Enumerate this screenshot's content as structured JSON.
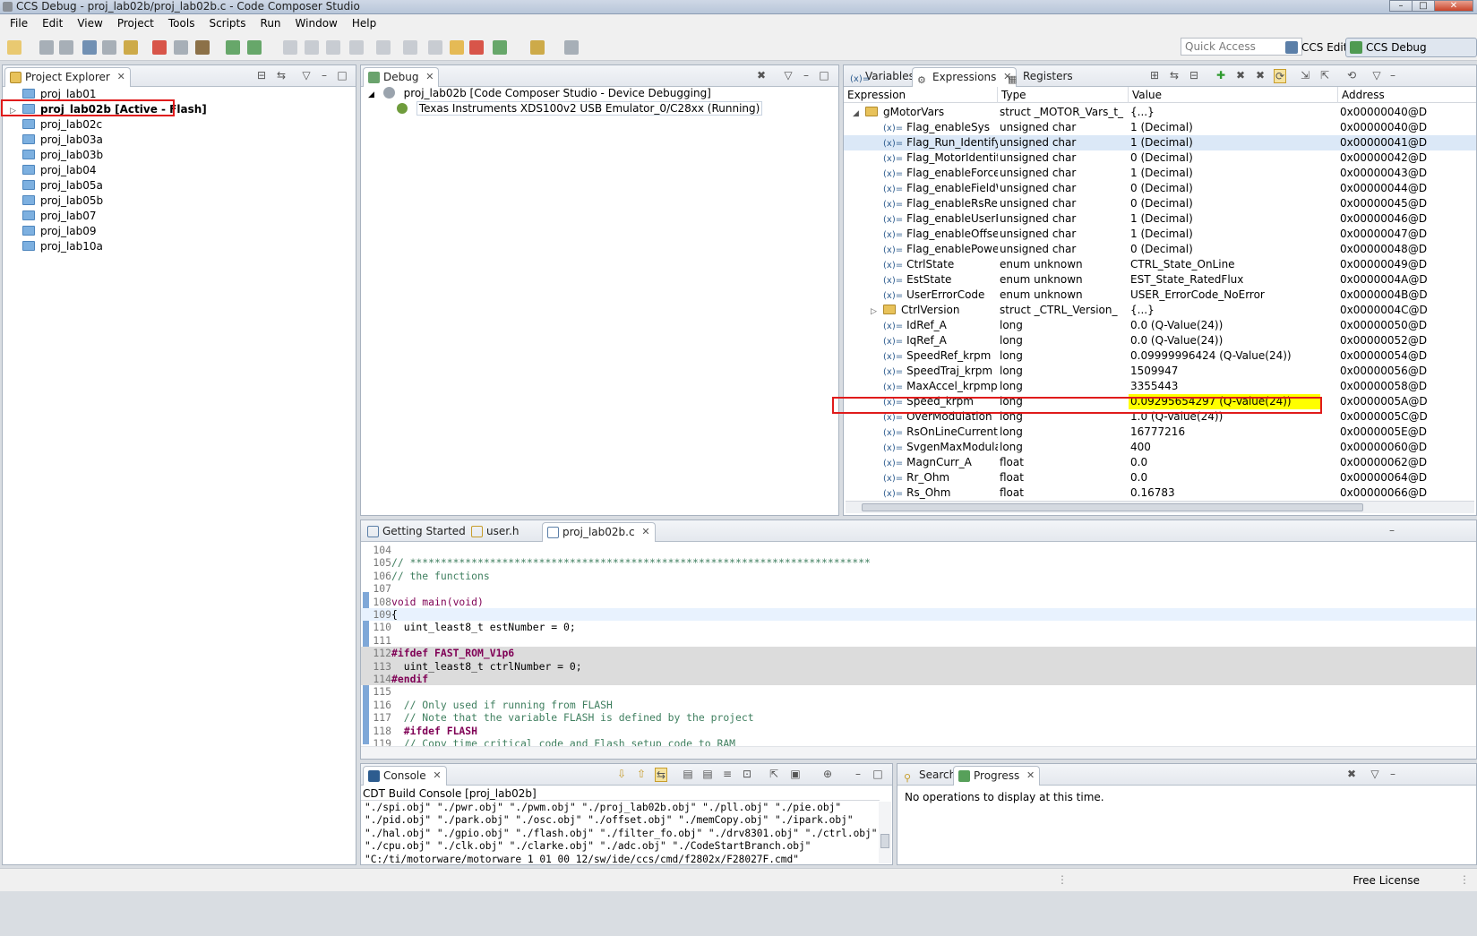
{
  "window": {
    "title": "CCS Debug - proj_lab02b/proj_lab02b.c - Code Composer Studio"
  },
  "menu": [
    "File",
    "Edit",
    "View",
    "Project",
    "Tools",
    "Scripts",
    "Run",
    "Window",
    "Help"
  ],
  "toolbar": {
    "quick_access_placeholder": "Quick Access",
    "perspectives": [
      "CCS Edit",
      "CCS Debug"
    ]
  },
  "project_explorer": {
    "tab": "Project Explorer",
    "items": [
      {
        "label": "proj_lab01",
        "active": false
      },
      {
        "label": "proj_lab02b  [Active - Flash]",
        "active": true
      },
      {
        "label": "proj_lab02c",
        "active": false
      },
      {
        "label": "proj_lab03a",
        "active": false
      },
      {
        "label": "proj_lab03b",
        "active": false
      },
      {
        "label": "proj_lab04",
        "active": false
      },
      {
        "label": "proj_lab05a",
        "active": false
      },
      {
        "label": "proj_lab05b",
        "active": false
      },
      {
        "label": "proj_lab07",
        "active": false
      },
      {
        "label": "proj_lab09",
        "active": false
      },
      {
        "label": "proj_lab10a",
        "active": false
      }
    ]
  },
  "debug": {
    "tab": "Debug",
    "session": "proj_lab02b [Code Composer Studio - Device Debugging]",
    "target": "Texas Instruments XDS100v2 USB Emulator_0/C28xx (Running)"
  },
  "expressions": {
    "tabs": [
      "Variables",
      "Expressions",
      "Registers"
    ],
    "columns": [
      "Expression",
      "Type",
      "Value",
      "Address"
    ],
    "rows": [
      {
        "name": "gMotorVars",
        "type": "struct _MOTOR_Vars_t_",
        "value": "{...}",
        "address": "0x00000040@D",
        "kind": "struct",
        "expanded": true
      },
      {
        "name": "Flag_enableSys",
        "type": "unsigned char",
        "value": "1 (Decimal)",
        "address": "0x00000040@D",
        "kind": "var"
      },
      {
        "name": "Flag_Run_Identify",
        "type": "unsigned char",
        "value": "1 (Decimal)",
        "address": "0x00000041@D",
        "kind": "var",
        "selected": true
      },
      {
        "name": "Flag_MotorIdentified",
        "type": "unsigned char",
        "value": "0 (Decimal)",
        "address": "0x00000042@D",
        "kind": "var"
      },
      {
        "name": "Flag_enableForceAng",
        "type": "unsigned char",
        "value": "1 (Decimal)",
        "address": "0x00000043@D",
        "kind": "var"
      },
      {
        "name": "Flag_enableFieldWeak",
        "type": "unsigned char",
        "value": "0 (Decimal)",
        "address": "0x00000044@D",
        "kind": "var"
      },
      {
        "name": "Flag_enableRsRecalc",
        "type": "unsigned char",
        "value": "0 (Decimal)",
        "address": "0x00000045@D",
        "kind": "var"
      },
      {
        "name": "Flag_enableUserParan",
        "type": "unsigned char",
        "value": "1 (Decimal)",
        "address": "0x00000046@D",
        "kind": "var"
      },
      {
        "name": "Flag_enableOffsetcalc",
        "type": "unsigned char",
        "value": "1 (Decimal)",
        "address": "0x00000047@D",
        "kind": "var"
      },
      {
        "name": "Flag_enablePowerWar",
        "type": "unsigned char",
        "value": "0 (Decimal)",
        "address": "0x00000048@D",
        "kind": "var"
      },
      {
        "name": "CtrlState",
        "type": "enum unknown",
        "value": "CTRL_State_OnLine",
        "address": "0x00000049@D",
        "kind": "var"
      },
      {
        "name": "EstState",
        "type": "enum unknown",
        "value": "EST_State_RatedFlux",
        "address": "0x0000004A@D",
        "kind": "var"
      },
      {
        "name": "UserErrorCode",
        "type": "enum unknown",
        "value": "USER_ErrorCode_NoError",
        "address": "0x0000004B@D",
        "kind": "var"
      },
      {
        "name": "CtrlVersion",
        "type": "struct _CTRL_Version_",
        "value": "{...}",
        "address": "0x0000004C@D",
        "kind": "struct",
        "expanded": false
      },
      {
        "name": "IdRef_A",
        "type": "long",
        "value": "0.0 (Q-Value(24))",
        "address": "0x00000050@D",
        "kind": "var"
      },
      {
        "name": "IqRef_A",
        "type": "long",
        "value": "0.0 (Q-Value(24))",
        "address": "0x00000052@D",
        "kind": "var"
      },
      {
        "name": "SpeedRef_krpm",
        "type": "long",
        "value": "0.09999996424 (Q-Value(24))",
        "address": "0x00000054@D",
        "kind": "var"
      },
      {
        "name": "SpeedTraj_krpm",
        "type": "long",
        "value": "1509947",
        "address": "0x00000056@D",
        "kind": "var"
      },
      {
        "name": "MaxAccel_krpmps",
        "type": "long",
        "value": "3355443",
        "address": "0x00000058@D",
        "kind": "var"
      },
      {
        "name": "Speed_krpm",
        "type": "long",
        "value": "0.09295654297 (Q-Value(24))",
        "address": "0x0000005A@D",
        "kind": "var",
        "highlight": true
      },
      {
        "name": "OverModulation",
        "type": "long",
        "value": "1.0 (Q-Value(24))",
        "address": "0x0000005C@D",
        "kind": "var"
      },
      {
        "name": "RsOnLineCurrent_A",
        "type": "long",
        "value": "16777216",
        "address": "0x0000005E@D",
        "kind": "var"
      },
      {
        "name": "SvgenMaxModulation",
        "type": "long",
        "value": "400",
        "address": "0x00000060@D",
        "kind": "var"
      },
      {
        "name": "MagnCurr_A",
        "type": "float",
        "value": "0.0",
        "address": "0x00000062@D",
        "kind": "var"
      },
      {
        "name": "Rr_Ohm",
        "type": "float",
        "value": "0.0",
        "address": "0x00000064@D",
        "kind": "var"
      },
      {
        "name": "Rs_Ohm",
        "type": "float",
        "value": "0.16783",
        "address": "0x00000066@D",
        "kind": "var"
      }
    ]
  },
  "editor": {
    "tabs": [
      "Getting Started",
      "user.h",
      "proj_lab02b.c"
    ],
    "lines": [
      {
        "n": "104",
        "t": "",
        "style": ""
      },
      {
        "n": "105",
        "t": "// ***************************************************************************",
        "style": "cm"
      },
      {
        "n": "106",
        "t": "// the functions",
        "style": "cm"
      },
      {
        "n": "107",
        "t": "",
        "style": ""
      },
      {
        "n": "108",
        "t": "void main(void)",
        "style": "fn"
      },
      {
        "n": "109",
        "t": "{",
        "style": "cur"
      },
      {
        "n": "110",
        "t": "  uint_least8_t estNumber = 0;",
        "style": ""
      },
      {
        "n": "111",
        "t": "",
        "style": ""
      },
      {
        "n": "112",
        "t": "#ifdef FAST_ROM_V1p6",
        "style": "inact-kw"
      },
      {
        "n": "113",
        "t": "  uint_least8_t ctrlNumber = 0;",
        "style": "inact"
      },
      {
        "n": "114",
        "t": "#endif",
        "style": "inact-kw"
      },
      {
        "n": "115",
        "t": "",
        "style": ""
      },
      {
        "n": "116",
        "t": "  // Only used if running from FLASH",
        "style": "cm"
      },
      {
        "n": "117",
        "t": "  // Note that the variable FLASH is defined by the project",
        "style": "cm"
      },
      {
        "n": "118",
        "t": "  #ifdef FLASH",
        "style": "kw"
      },
      {
        "n": "119",
        "t": "  // Copy time critical code and Flash setup code to RAM",
        "style": "cm"
      }
    ]
  },
  "console": {
    "tab": "Console",
    "title": "CDT Build Console [proj_lab02b]",
    "lines": [
      "\"./spi.obj\" \"./pwr.obj\" \"./pwm.obj\" \"./proj_lab02b.obj\" \"./pll.obj\" \"./pie.obj\"",
      "\"./pid.obj\" \"./park.obj\" \"./osc.obj\" \"./offset.obj\" \"./memCopy.obj\" \"./ipark.obj\"",
      "\"./hal.obj\" \"./gpio.obj\" \"./flash.obj\" \"./filter_fo.obj\" \"./drv8301.obj\" \"./ctrl.obj\"",
      "\"./cpu.obj\" \"./clk.obj\" \"./clarke.obj\" \"./adc.obj\" \"./CodeStartBranch.obj\"",
      "\"C:/ti/motorware/motorware_1_01_00_12/sw/ide/ccs/cmd/f2802x/F28027F.cmd\""
    ]
  },
  "progress": {
    "tabs": [
      "Search",
      "Progress"
    ],
    "message": "No operations to display at this time."
  },
  "status": {
    "license": "Free License"
  },
  "colors": {
    "highlight": "#ffff00",
    "annotation_box": "#e01b1b",
    "selection": "#dbe8f7"
  }
}
